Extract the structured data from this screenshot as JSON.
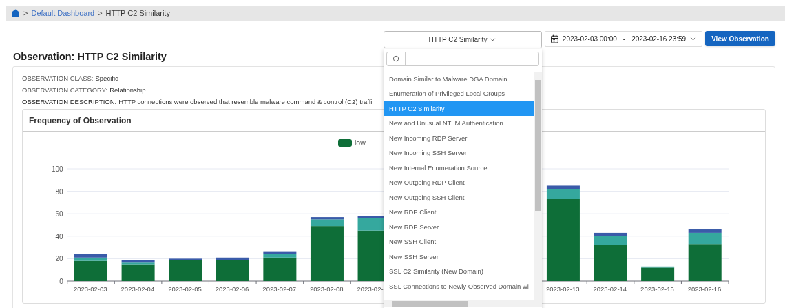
{
  "breadcrumb": [
    {
      "separator": ">",
      "label": "Default Dashboard",
      "kind": "link"
    },
    {
      "separator": ">",
      "label": "HTTP C2 Similarity",
      "kind": "current"
    }
  ],
  "observation_select": {
    "value": "HTTP C2 Similarity",
    "expanded": true,
    "items": [
      {
        "label": "Domain Similar to Malware DGA Domain",
        "selected": false
      },
      {
        "label": "Enumeration of Privileged Local Groups",
        "selected": false
      },
      {
        "label": "HTTP C2 Similarity",
        "selected": true
      },
      {
        "label": "New and Unusual NTLM Authentication",
        "selected": false
      },
      {
        "label": "New Incoming RDP Server",
        "selected": false
      },
      {
        "label": "New Incoming SSH Server",
        "selected": false
      },
      {
        "label": "New Internal Enumeration Source",
        "selected": false
      },
      {
        "label": "New Outgoing RDP Client",
        "selected": false
      },
      {
        "label": "New Outgoing SSH Client",
        "selected": false
      },
      {
        "label": "New RDP Client",
        "selected": false
      },
      {
        "label": "New RDP Server",
        "selected": false
      },
      {
        "label": "New SSH Client",
        "selected": false
      },
      {
        "label": "New SSH Server",
        "selected": false
      },
      {
        "label": "SSL C2 Similarity (New Domain)",
        "selected": false
      },
      {
        "label": "SSL Connections to Newly Observed Domain wi",
        "selected": false
      }
    ]
  },
  "date_range": {
    "start": "2023-02-03 00:00",
    "separator": "-",
    "end": "2023-02-16 23:59"
  },
  "view_button": "View Observation",
  "title": "Observation: HTTP C2 Similarity",
  "details": [
    {
      "label": "OBSERVATION CLASS:",
      "value": "Specific"
    },
    {
      "label": "OBSERVATION CATEGORY:",
      "value": "Relationship"
    },
    {
      "label": "OBSERVATION DESCRIPTION:",
      "value": "HTTP connections were observed that resemble malware command & control (C2) traffi"
    }
  ],
  "chart_panel": {
    "title": "Frequency of Observation",
    "chart_data": {
      "type": "bar",
      "stacked": true,
      "grid": true,
      "categories": [
        "2023-02-03",
        "2023-02-04",
        "2023-02-05",
        "2023-02-06",
        "2023-02-07",
        "2023-02-08",
        "2023-02-",
        null,
        null,
        null,
        "2023-02-13",
        "2023-02-14",
        "2023-02-15",
        "2023-02-16"
      ],
      "ylim": [
        0,
        100
      ],
      "yticks": [
        0,
        20,
        40,
        60,
        80,
        100
      ],
      "series": [
        {
          "name": "low",
          "color": "#0e6e38",
          "values": [
            18,
            15,
            19,
            19,
            21,
            49,
            45,
            null,
            null,
            null,
            73,
            32,
            12,
            33
          ]
        },
        {
          "color": "#35a89e",
          "values": [
            3,
            2,
            0,
            0,
            3,
            6,
            11,
            null,
            null,
            null,
            9,
            8,
            1,
            10
          ]
        },
        {
          "color": "#3a5ba9",
          "values": [
            3,
            2,
            1,
            2,
            2,
            2,
            2,
            null,
            null,
            null,
            3,
            3,
            0,
            3
          ]
        }
      ]
    }
  }
}
